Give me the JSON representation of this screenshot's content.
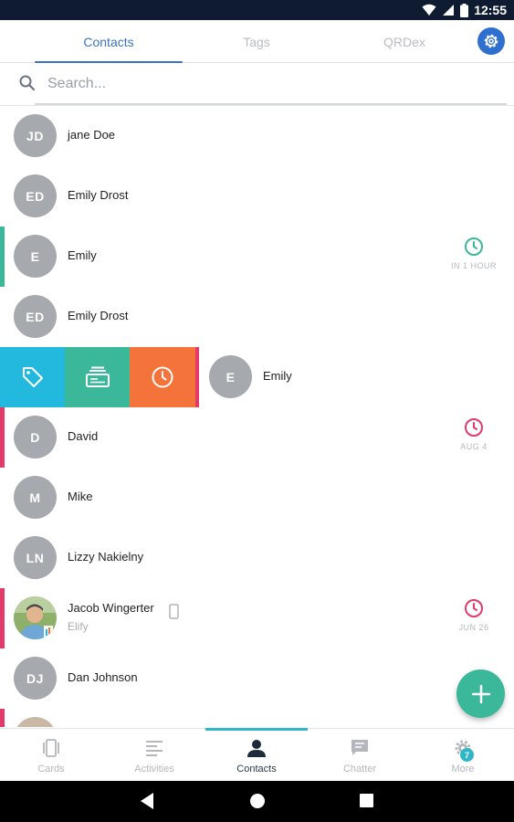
{
  "status_bar": {
    "time": "12:55",
    "icons": [
      "wifi-icon",
      "signal-icon",
      "battery-icon"
    ]
  },
  "top_tabs": [
    {
      "label": "Contacts",
      "active": true
    },
    {
      "label": "Tags",
      "active": false
    },
    {
      "label": "QRDex",
      "active": false
    }
  ],
  "search": {
    "placeholder": "Search..."
  },
  "contacts": [
    {
      "initials": "JD",
      "name": "jane Doe"
    },
    {
      "initials": "ED",
      "name": "Emily Drost"
    },
    {
      "initials": "E",
      "name": "Emily",
      "reminder": "IN 1 HOUR",
      "accent_color": "#3bb79a"
    },
    {
      "initials": "ED",
      "name": "Emily Drost"
    },
    {
      "initials": "E",
      "name": "Emily",
      "swiped": true,
      "accent_color": "#e23a6b"
    },
    {
      "initials": "D",
      "name": "David",
      "reminder": "AUG 4",
      "accent_color": "#e23a6b"
    },
    {
      "initials": "M",
      "name": "Mike"
    },
    {
      "initials": "LN",
      "name": "Lizzy Nakielny"
    },
    {
      "initials": "",
      "name": "Jacob Wingerter",
      "company": "Elify",
      "reminder": "JUN 26",
      "accent_color": "#e23a6b"
    },
    {
      "initials": "DJ",
      "name": "Dan Johnson"
    }
  ],
  "swipe_actions": [
    "tag-icon",
    "card-icon",
    "clock-icon"
  ],
  "bottom_nav": [
    {
      "label": "Cards",
      "active": false
    },
    {
      "label": "Activities",
      "active": false
    },
    {
      "label": "Contacts",
      "active": true
    },
    {
      "label": "Chatter",
      "active": false
    },
    {
      "label": "More",
      "active": false,
      "badge": "7"
    }
  ],
  "colors": {
    "accent_blue": "#3b73c2",
    "teal": "#3bb79a",
    "pink": "#e23a6b",
    "orange": "#f4733b",
    "cyan": "#23b9de"
  }
}
